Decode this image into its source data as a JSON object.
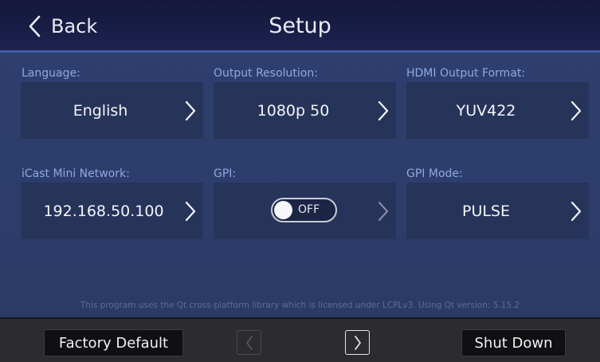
{
  "header": {
    "back_label": "Back",
    "title": "Setup"
  },
  "settings": [
    {
      "label": "Language:",
      "value": "English"
    },
    {
      "label": "Output Resolution:",
      "value": "1080p 50"
    },
    {
      "label": "HDMI Output Format:",
      "value": "YUV422"
    },
    {
      "label": "iCast Mini Network:",
      "value": "192.168.50.100"
    },
    {
      "label": "GPI:",
      "toggle": "OFF"
    },
    {
      "label": "GPI Mode:",
      "value": "PULSE"
    }
  ],
  "license_text": "This program uses the Qt cross-platform library which is licensed under LCPLv3. Using Qt version: 5.15.2",
  "bottom_bar": {
    "factory_default_label": "Factory Default",
    "shut_down_label": "Shut Down"
  },
  "icons": {
    "back": "chevron-left-icon",
    "tile_arrow": "chevron-right-icon",
    "nav_prev": "chevron-left-icon",
    "nav_next": "chevron-right-icon"
  },
  "colors": {
    "header_bg": "#191d45",
    "panel_bg": "#2e3f6f",
    "tile_bg": "#263459",
    "label_text": "#8fa7df",
    "header_accent": "#3d5fa6",
    "bottom_bar_bg": "#2b2b30"
  }
}
